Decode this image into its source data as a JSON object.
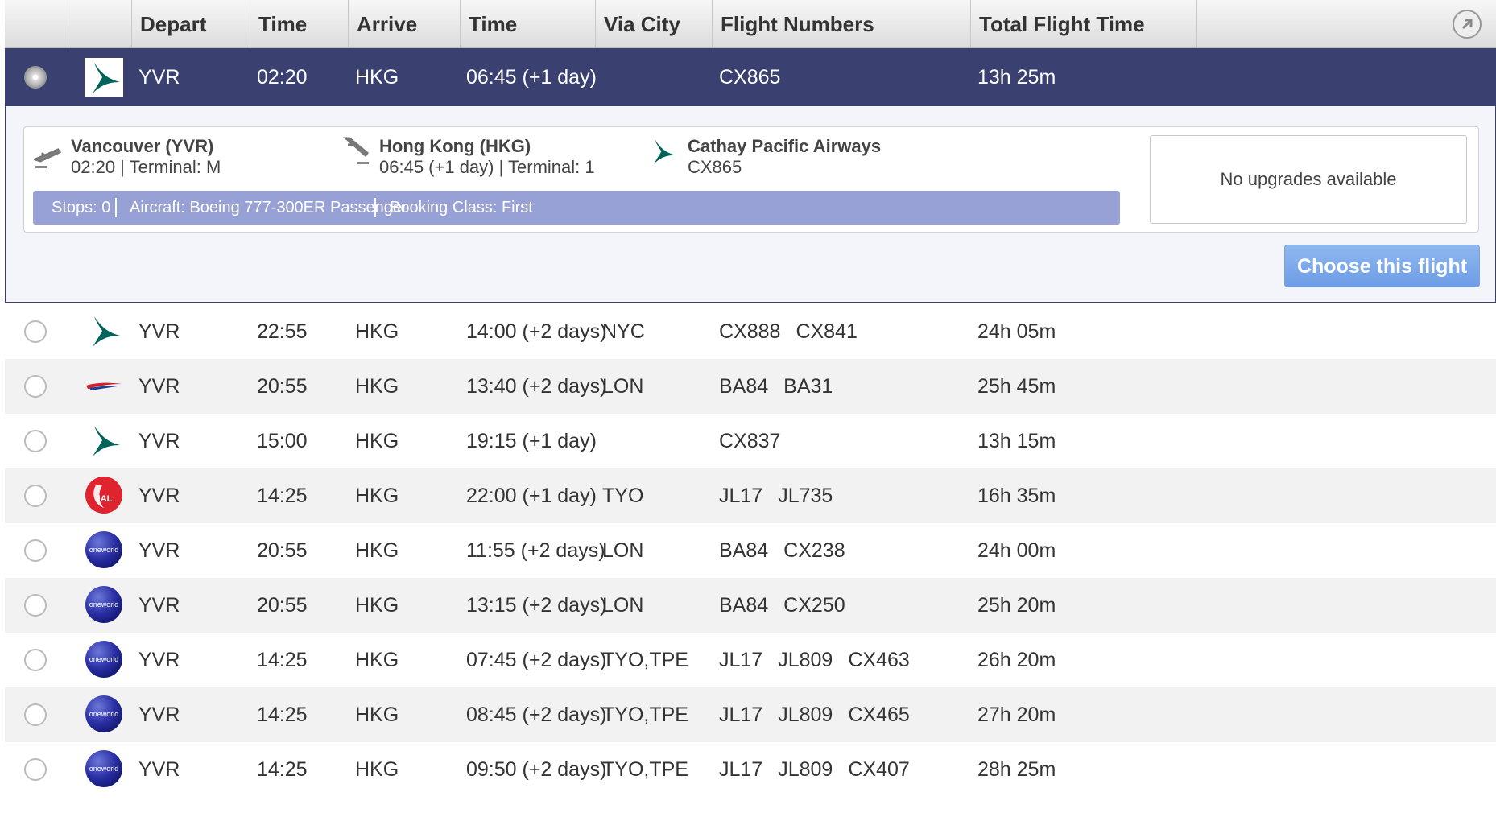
{
  "header": {
    "columns": [
      "Depart",
      "Time",
      "Arrive",
      "Time",
      "Via City",
      "Flight Numbers",
      "Total Flight Time"
    ],
    "icon": "arrow-circle-icon"
  },
  "selected": {
    "airline_logo": "cathay-pacific-logo",
    "depart": "YVR",
    "depart_time": "02:20",
    "arrive": "HKG",
    "arrive_time": "06:45 (+1 day)",
    "via": "",
    "flights": "CX865",
    "total": "13h 25m",
    "detail": {
      "origin_name": "Vancouver (YVR)",
      "origin_info": "02:20 | Terminal: M",
      "dest_name": "Hong Kong (HKG)",
      "dest_info": "06:45 (+1 day) | Terminal: 1",
      "airline_name": "Cathay Pacific Airways",
      "airline_flight": "CX865",
      "stops": "Stops: 0",
      "aircraft": "Aircraft: Boeing 777-300ER Passenger",
      "booking_class": "Booking Class: First",
      "upgrades": "No upgrades available",
      "choose_label": "Choose this flight"
    }
  },
  "rows": [
    {
      "logo": "cathay",
      "depart": "YVR",
      "dtime": "22:55",
      "arrive": "HKG",
      "atime": "14:00 (+2 days)",
      "via": "NYC",
      "flights": [
        "CX888",
        "CX841"
      ],
      "total": "24h 05m"
    },
    {
      "logo": "british-airways",
      "depart": "YVR",
      "dtime": "20:55",
      "arrive": "HKG",
      "atime": "13:40 (+2 days)",
      "via": "LON",
      "flights": [
        "BA84",
        "BA31"
      ],
      "total": "25h 45m"
    },
    {
      "logo": "cathay",
      "depart": "YVR",
      "dtime": "15:00",
      "arrive": "HKG",
      "atime": "19:15 (+1 day)",
      "via": "",
      "flights": [
        "CX837"
      ],
      "total": "13h 15m"
    },
    {
      "logo": "jal",
      "depart": "YVR",
      "dtime": "14:25",
      "arrive": "HKG",
      "atime": "22:00 (+1 day)",
      "via": "TYO",
      "flights": [
        "JL17",
        "JL735"
      ],
      "total": "16h 35m"
    },
    {
      "logo": "oneworld",
      "depart": "YVR",
      "dtime": "20:55",
      "arrive": "HKG",
      "atime": "11:55 (+2 days)",
      "via": "LON",
      "flights": [
        "BA84",
        "CX238"
      ],
      "total": "24h 00m"
    },
    {
      "logo": "oneworld",
      "depart": "YVR",
      "dtime": "20:55",
      "arrive": "HKG",
      "atime": "13:15 (+2 days)",
      "via": "LON",
      "flights": [
        "BA84",
        "CX250"
      ],
      "total": "25h 20m"
    },
    {
      "logo": "oneworld",
      "depart": "YVR",
      "dtime": "14:25",
      "arrive": "HKG",
      "atime": "07:45 (+2 days)",
      "via": "TYO,TPE",
      "flights": [
        "JL17",
        "JL809",
        "CX463"
      ],
      "total": "26h 20m"
    },
    {
      "logo": "oneworld",
      "depart": "YVR",
      "dtime": "14:25",
      "arrive": "HKG",
      "atime": "08:45 (+2 days)",
      "via": "TYO,TPE",
      "flights": [
        "JL17",
        "JL809",
        "CX465"
      ],
      "total": "27h 20m"
    },
    {
      "logo": "oneworld",
      "depart": "YVR",
      "dtime": "14:25",
      "arrive": "HKG",
      "atime": "09:50 (+2 days)",
      "via": "TYO,TPE",
      "flights": [
        "JL17",
        "JL809",
        "CX407"
      ],
      "total": "28h 25m"
    }
  ],
  "logo_text": {
    "jal": "JAL",
    "oneworld": "oneworld"
  }
}
